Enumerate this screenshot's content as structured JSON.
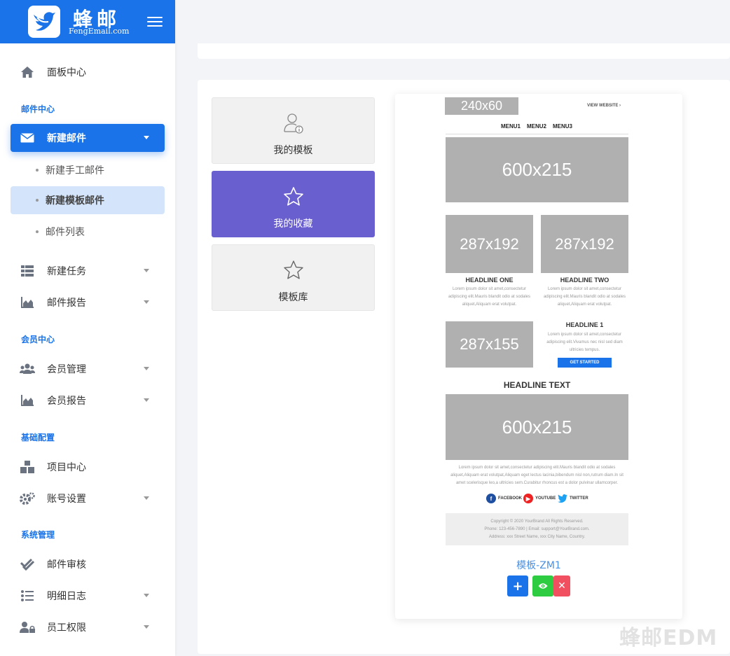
{
  "brand": {
    "name_cn": "蜂邮",
    "name_en": "FengEmail.com"
  },
  "sidebar": {
    "dashboard": "面板中心",
    "sections": {
      "mail": "邮件中心",
      "member": "会员中心",
      "config": "基础配置",
      "system": "系统管理"
    },
    "new_mail": "新建邮件",
    "sub": {
      "manual": "新建手工邮件",
      "template": "新建模板邮件",
      "list": "邮件列表"
    },
    "new_task": "新建任务",
    "mail_report": "邮件报告",
    "member_manage": "会员管理",
    "member_report": "会员报告",
    "project": "项目中心",
    "account": "账号设置",
    "mail_review": "邮件审核",
    "log": "明细日志",
    "staff": "员工权限"
  },
  "tiles": {
    "my_templates": "我的模板",
    "favorites": "我的收藏",
    "library": "模板库"
  },
  "preview": {
    "logo_ph": "240x60",
    "view_website": "VIEW WEBSITE ›",
    "menus": [
      "MENU1",
      "MENU2",
      "MENU3"
    ],
    "hero_ph": "600x215",
    "col_ph": "287x192",
    "headline_one": "HEADLINE ONE",
    "headline_two": "HEADLINE TWO",
    "small_text": "Lorem ipsum dolor sit amet,consectetur adipiscing elit.Mauris blandit odio at sodales aliquet,Aliquam erat volutpat.",
    "ph_155": "287x155",
    "headline1": "HEADLINE 1",
    "side_text": "Lorem ipsum dolor sit amet,consectetur adipiscing elit.Vivamus nec nisl sed diam ultricies tempus.",
    "get_started": "GET STARTED",
    "headline_text": "HEADLINE TEXT",
    "hero2_ph": "600x215",
    "body_text": "Lorem ipsum dolor sit amet,consectetur adipiscing elit.Mauris blandit odio at sodales aliquet,Aliquam erat volutpat,Aliquam eget lectus lacinia,bibendum nisl non,rutrum diam.In sit amet scelerisque leo,a ultricies sem.Curabitur rhoncus est a dolor pulvinar ullamcorper.",
    "facebook": "FACEBOOK",
    "youtube": "YOUTUBE",
    "twitter": "TWITTER",
    "footer_line1": "Copyright © 2020 YourBrand All Rights Reserved.",
    "footer_line2": "Phone: 123-456-7890 | Email: support@YourBrand.com.",
    "footer_line3": "Address: xxx Street Name, xxx City Name, Country.",
    "name": "模板-ZM1"
  },
  "actions": {
    "add": "+",
    "delete": "✕"
  },
  "watermark": "蜂邮EDM",
  "colors": {
    "primary": "#1a73e8",
    "purple": "#6a5fcf",
    "green": "#2ecc40",
    "red": "#f05060"
  }
}
